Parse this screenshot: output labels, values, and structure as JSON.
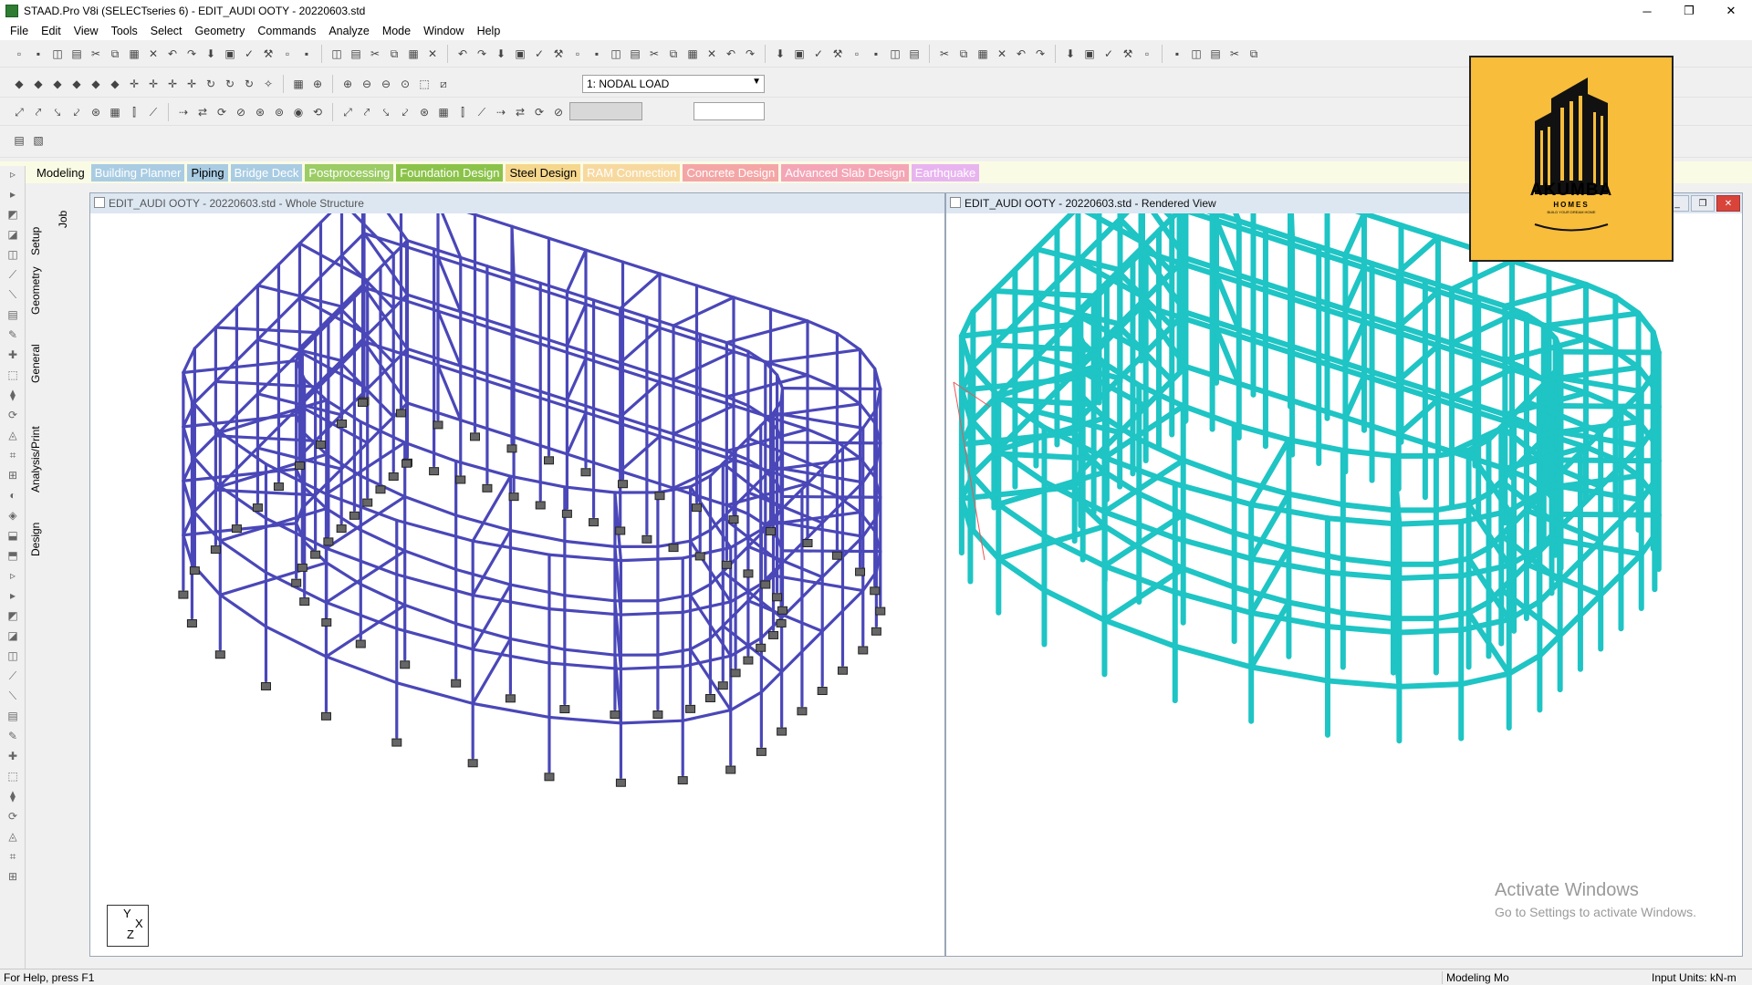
{
  "window": {
    "title": "STAAD.Pro V8i (SELECTseries 6) - EDIT_AUDI OOTY - 20220603.std",
    "minimize": "─",
    "restore": "❐",
    "close": "✕"
  },
  "menu": [
    "File",
    "Edit",
    "View",
    "Tools",
    "Select",
    "Geometry",
    "Commands",
    "Analyze",
    "Mode",
    "Window",
    "Help"
  ],
  "toolbar": {
    "load_case": "1: NODAL LOAD"
  },
  "mode_tabs": [
    {
      "label": "Modeling",
      "bg": "#fafbe4",
      "color": "#000000"
    },
    {
      "label": "Building Planner",
      "bg": "#a9cce3",
      "color": "#ffffff"
    },
    {
      "label": "Piping",
      "bg": "#a9cce3",
      "color": "#000000"
    },
    {
      "label": "Bridge Deck",
      "bg": "#a9cce3",
      "color": "#ffffff"
    },
    {
      "label": "Postprocessing",
      "bg": "#9ccc65",
      "color": "#ffffff"
    },
    {
      "label": "Foundation Design",
      "bg": "#8bc34a",
      "color": "#ffffff"
    },
    {
      "label": "Steel Design",
      "bg": "#f5d78e",
      "color": "#000000"
    },
    {
      "label": "RAM Connection",
      "bg": "#f7d9a0",
      "color": "#ffffff"
    },
    {
      "label": "Concrete Design",
      "bg": "#f4a6a6",
      "color": "#ffffff"
    },
    {
      "label": "Advanced Slab Design",
      "bg": "#f4a6b6",
      "color": "#ffffff"
    },
    {
      "label": "Earthquake",
      "bg": "#e8b4f0",
      "color": "#ffffff"
    }
  ],
  "side_tabs": {
    "job": "Job",
    "setup": "Setup",
    "geometry": "Geometry",
    "general": "General",
    "analysis": "Analysis/Print",
    "design": "Design"
  },
  "left_view": {
    "title": "EDIT_AUDI OOTY - 20220603.std - Whole Structure",
    "axis_y": "Y",
    "axis_x": "X",
    "axis_z": "Z",
    "frame_color": "#4a47b8"
  },
  "right_view": {
    "title": "EDIT_AUDI OOTY - 20220603.std - Rendered View",
    "frame_color": "#1fc4c4",
    "watermark_line1": "Activate Windows",
    "watermark_line2": "Go to Settings to activate Windows."
  },
  "logo": {
    "name": "AKUMBA",
    "sub": "HOMES",
    "tagline": "BUILD YOUR DREAM HOME",
    "bg": "#f7bd3b"
  },
  "status": {
    "help": "For Help, press F1",
    "mode": "Modeling Mo",
    "units": "Input Units:   kN-m"
  }
}
